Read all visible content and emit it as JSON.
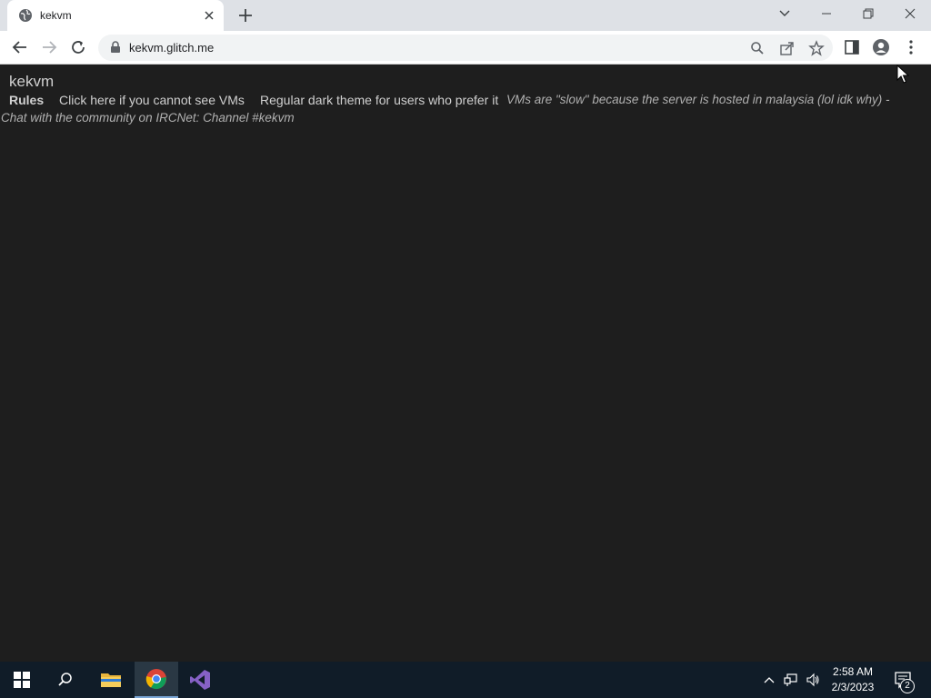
{
  "browser": {
    "tab_title": "kekvm",
    "url": "kekvm.glitch.me"
  },
  "page": {
    "site_title": "kekvm",
    "links": {
      "rules": "Rules",
      "cannot_see": "Click here if you cannot see VMs",
      "dark_theme": "Regular dark theme for users who prefer it"
    },
    "notice_line1": "VMs are \"slow\" because the server is hosted in malaysia (lol idk why) -",
    "notice_line2": "Chat with the community on IRCNet: Channel #kekvm"
  },
  "taskbar": {
    "time": "2:58 AM",
    "date": "2/3/2023",
    "notifications": "2"
  }
}
